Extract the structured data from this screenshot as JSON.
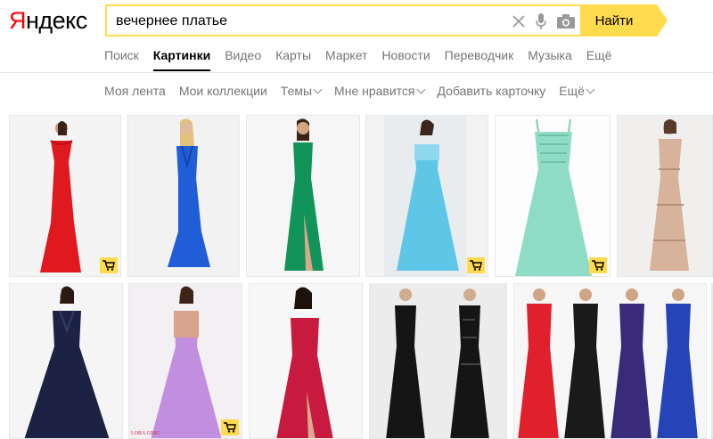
{
  "logo": {
    "first_letter": "Я",
    "rest": "ндекс"
  },
  "search": {
    "value": "вечернее платье",
    "button_label": "Найти"
  },
  "services": [
    {
      "label": "Поиск",
      "active": false
    },
    {
      "label": "Картинки",
      "active": true
    },
    {
      "label": "Видео",
      "active": false
    },
    {
      "label": "Карты",
      "active": false
    },
    {
      "label": "Маркет",
      "active": false
    },
    {
      "label": "Новости",
      "active": false
    },
    {
      "label": "Переводчик",
      "active": false
    },
    {
      "label": "Музыка",
      "active": false
    },
    {
      "label": "Ещё",
      "active": false
    }
  ],
  "subnav": {
    "feed": "Моя лента",
    "collections": "Мои коллекции",
    "themes": "Темы",
    "likes": "Мне нравится",
    "add_card": "Добавить карточку",
    "more": "Ещё"
  },
  "images": {
    "watermark_8": "LORA GRIG"
  },
  "colors": {
    "accent": "#ffdb4d",
    "logo_red": "#ff0000",
    "text_muted": "#757575"
  }
}
